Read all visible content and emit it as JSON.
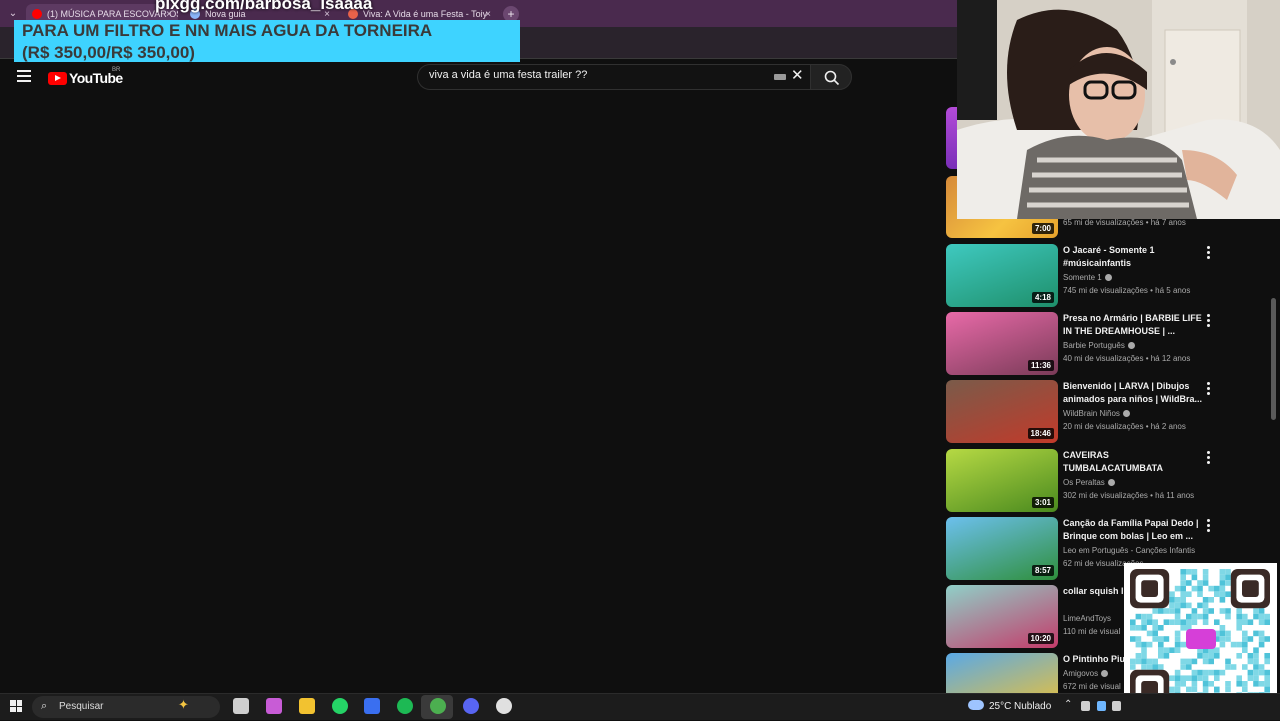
{
  "browser": {
    "tabs": [
      {
        "title": "(1) MÚSICA PARA ESCOVAR OS",
        "favicon_color": "#ff0000",
        "active": true
      },
      {
        "title": "Nova guia",
        "favicon_color": "#8ab4f8",
        "active": false
      },
      {
        "title": "Viva: A Vida é uma Festa - Toiy",
        "favicon_color": "#e8624a",
        "active": false
      }
    ],
    "new_tab_symbol": "+",
    "tab_close_symbol": "×",
    "tab_menu_symbol": "⌄"
  },
  "overlay": {
    "pix_url": "pixgg.com/barbosa_isaaaa",
    "promo_line1": "PARA UM FILTRO E NN MAIS AGUA DA TORNEIRA",
    "promo_line2": "(R$ 350,00/R$ 350,00)"
  },
  "youtube": {
    "logo_text": "YouTube",
    "region": "BR",
    "search_query": "viva a vida é uma festa trailer ??",
    "clear_symbol": "✕"
  },
  "sidebar": {
    "partial_stats": "65 mi de visualizações • há 7 anos",
    "partial_duration": "7:00",
    "videos": [
      {
        "title": "O Jacaré  - Somente 1 #músicainfantis",
        "channel": "Somente 1",
        "verified": true,
        "stats": "745 mi de visualizações • há 5 anos",
        "duration": "4:18",
        "thumb_colors": [
          "#3fc9c0",
          "#1e8f6a"
        ]
      },
      {
        "title": "Presa no Armário  | BARBIE LIFE IN THE DREAMHOUSE | ...",
        "channel": "Barbie Português",
        "verified": true,
        "stats": "40 mi de visualizações • há 12 anos",
        "duration": "11:36",
        "thumb_colors": [
          "#e86aa8",
          "#7a3b58"
        ]
      },
      {
        "title": "Bienvenido | LARVA | Dibujos animados para niños | WildBra...",
        "channel": "WildBrain Niños",
        "verified": true,
        "stats": "20 mi de visualizações • há 2 anos",
        "duration": "18:46",
        "thumb_colors": [
          "#7a5b4a",
          "#c23a2a"
        ]
      },
      {
        "title": "CAVEIRAS TUMBALACATUMBATA",
        "channel": "Os Peraltas",
        "verified": true,
        "stats": "302 mi de visualizações • há 11 anos",
        "duration": "3:01",
        "thumb_colors": [
          "#b6d944",
          "#4a8a1e"
        ]
      },
      {
        "title": "Canção da Família Papai Dedo | Brinque com bolas | Leo em ...",
        "channel": "Leo em Português - Canções Infantis",
        "verified": false,
        "stats": "62 mi de visualizações",
        "duration": "8:57",
        "thumb_colors": [
          "#6cc0ee",
          "#2f8f3c"
        ]
      },
      {
        "title": "collar squish l Seven Steps +",
        "channel": "LimeAndToys",
        "verified": false,
        "stats": "110 mi de visual",
        "duration": "10:20",
        "thumb_colors": [
          "#8fd0c8",
          "#c43b6a"
        ]
      },
      {
        "title": "O Pintinho Piu",
        "channel": "Amigovos",
        "verified": true,
        "stats": "672 mi de visual",
        "duration": "",
        "thumb_colors": [
          "#5aa9e6",
          "#f2c230"
        ]
      }
    ]
  },
  "taskbar": {
    "search_placeholder": "Pesquisar",
    "weather_temp": "25°C",
    "weather_condition": "Nublado",
    "apps": [
      {
        "name": "task-view-icon",
        "color": "#cfcfcf"
      },
      {
        "name": "copilot-icon",
        "color": "#c85cd6"
      },
      {
        "name": "file-explorer-icon",
        "color": "#f2c230"
      },
      {
        "name": "whatsapp-icon",
        "color": "#25d366"
      },
      {
        "name": "droplet-app-icon",
        "color": "#3a6ff0"
      },
      {
        "name": "spotify-icon",
        "color": "#1db954"
      },
      {
        "name": "chrome-icon",
        "color": "#4caf50"
      },
      {
        "name": "discord-icon",
        "color": "#5865f2"
      },
      {
        "name": "clock-app-icon",
        "color": "#e0e0e0"
      }
    ]
  }
}
